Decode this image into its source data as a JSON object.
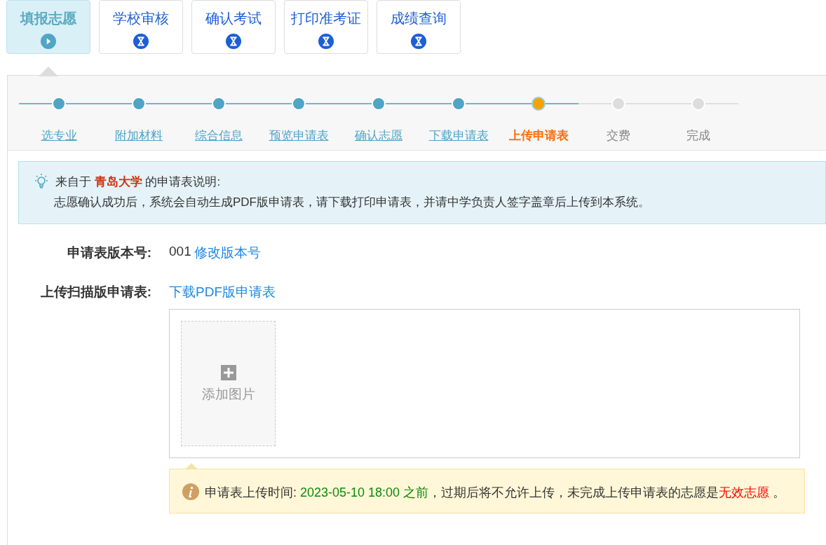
{
  "stage_tabs": [
    {
      "label": "填报志愿",
      "selected": true,
      "kind": "current"
    },
    {
      "label": "学校审核",
      "selected": false,
      "kind": "pending"
    },
    {
      "label": "确认考试",
      "selected": false,
      "kind": "pending"
    },
    {
      "label": "打印准考证",
      "selected": false,
      "kind": "pending"
    },
    {
      "label": "成绩查询",
      "selected": false,
      "kind": "pending"
    }
  ],
  "steps": [
    {
      "label": "选专业",
      "kind": "done"
    },
    {
      "label": "附加材料",
      "kind": "done"
    },
    {
      "label": "综合信息",
      "kind": "done"
    },
    {
      "label": "预览申请表",
      "kind": "done"
    },
    {
      "label": "确认志愿",
      "kind": "done"
    },
    {
      "label": "下载申请表",
      "kind": "done"
    },
    {
      "label": "上传申请表",
      "kind": "current"
    },
    {
      "label": "交费",
      "kind": "todo"
    },
    {
      "label": "完成",
      "kind": "todo"
    }
  ],
  "info": {
    "heading": [
      {
        "text": "来自于 ",
        "kind": "plain"
      },
      {
        "text": "青岛大学",
        "kind": "school"
      },
      {
        "text": " 的申请表说明:",
        "kind": "plain"
      }
    ],
    "body": "志愿确认成功后，系统会自动生成PDF版申请表，请下载打印申请表，并请中学负责人签字盖章后上传到本系统。"
  },
  "version_row": {
    "label": "申请表版本号:",
    "value": "001",
    "link": "修改版本号"
  },
  "upload_row": {
    "label": "上传扫描版申请表:",
    "link": "下载PDF版申请表",
    "add_tile": "添加图片"
  },
  "notice": [
    {
      "text": "申请表上传时间: ",
      "kind": "plain"
    },
    {
      "text": "2023-05-10 18:00 之前",
      "kind": "deadline"
    },
    {
      "text": "，过期后将不允许上传，未完成上传申请表的志愿是",
      "kind": "plain"
    },
    {
      "text": "无效志愿",
      "kind": "warning"
    },
    {
      "text": " 。",
      "kind": "plain"
    }
  ]
}
